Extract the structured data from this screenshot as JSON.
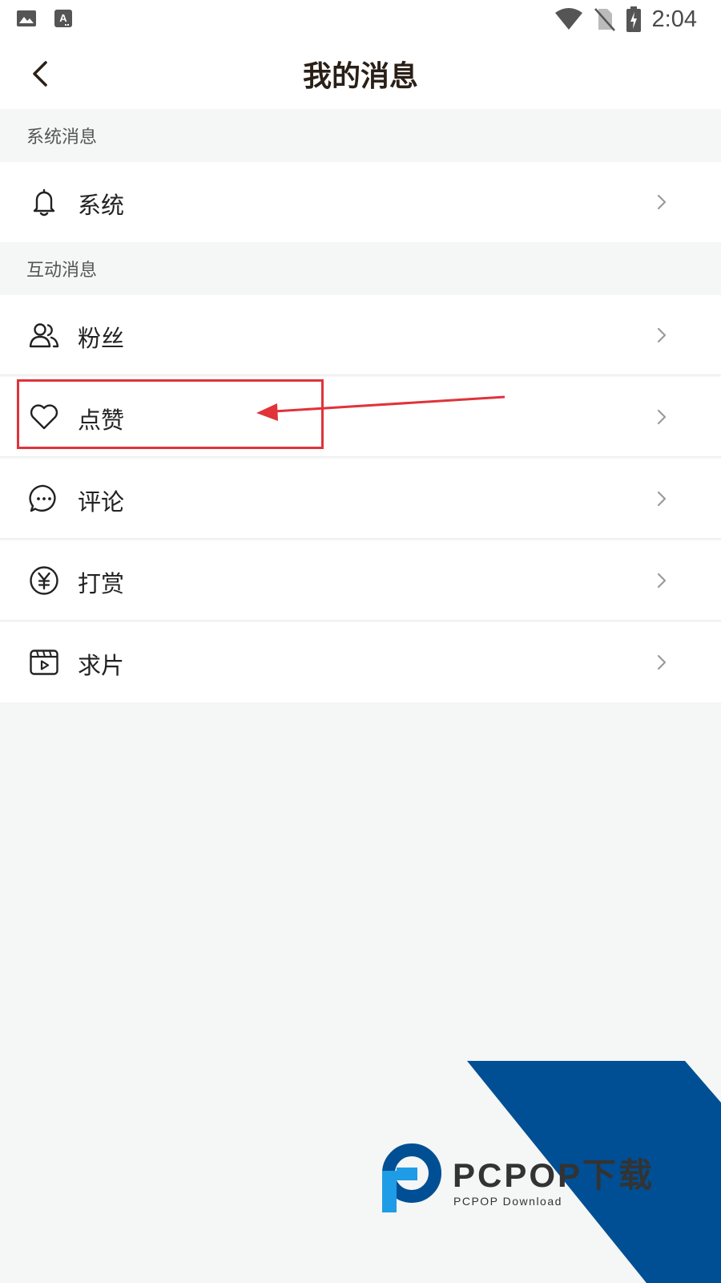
{
  "status_bar": {
    "time": "2:04",
    "left_icons": [
      "image-icon",
      "keyboard-a-icon"
    ],
    "right_icons": [
      "wifi-icon",
      "no-sim-icon",
      "battery-charging-icon"
    ]
  },
  "header": {
    "title": "我的消息",
    "back_icon": "chevron-left-icon"
  },
  "sections": [
    {
      "title": "系统消息",
      "items": [
        {
          "label": "系统",
          "icon": "bell-icon"
        }
      ]
    },
    {
      "title": "互动消息",
      "items": [
        {
          "label": "粉丝",
          "icon": "fans-icon"
        },
        {
          "label": "点赞",
          "icon": "heart-icon"
        },
        {
          "label": "评论",
          "icon": "comment-icon"
        },
        {
          "label": "打赏",
          "icon": "yuan-icon"
        },
        {
          "label": "求片",
          "icon": "video-request-icon"
        }
      ]
    }
  ],
  "annotation": {
    "color": "#e0333a",
    "highlighted_item": "点赞"
  },
  "watermark": {
    "brand": "PCPOP下载",
    "subtitle": "PCPOP Download",
    "colors": {
      "blue": "#004f94",
      "light_blue": "#1f9ce6",
      "dark": "#333333"
    }
  },
  "colors": {
    "background": "#f5f6f6",
    "surface": "#ffffff",
    "title": "#2a1f16",
    "text": "#222222",
    "section_text": "#555555",
    "chevron": "#9a9a9a"
  }
}
